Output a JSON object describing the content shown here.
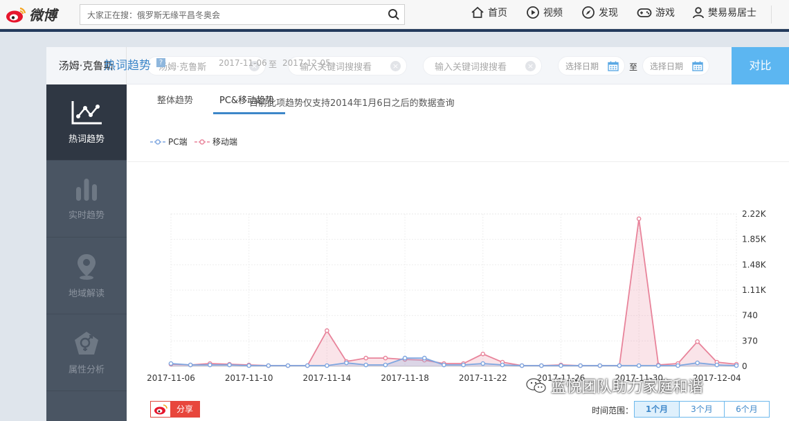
{
  "header": {
    "logo_text": "微博",
    "search_text": "大家正在搜：俄罗斯无缘平昌冬奥会",
    "nav": [
      {
        "label": "首页",
        "icon": "home-icon"
      },
      {
        "label": "视频",
        "icon": "play-icon"
      },
      {
        "label": "发现",
        "icon": "compass-icon"
      },
      {
        "label": "游戏",
        "icon": "gamepad-icon"
      },
      {
        "label": "樊易易居士",
        "icon": "user-icon"
      }
    ]
  },
  "filter": {
    "name_label": "汤姆·克鲁斯",
    "keyword1": "汤姆·克鲁斯",
    "keyword2_placeholder": "输入关键词搜搜看",
    "keyword3_placeholder": "输入关键词搜搜看",
    "date_start_placeholder": "选择日期",
    "to_label": "至",
    "date_end_placeholder": "选择日期",
    "compare_label": "对比"
  },
  "sidebar": {
    "items": [
      {
        "label": "热词趋势",
        "icon": "trend-icon",
        "active": true
      },
      {
        "label": "实时趋势",
        "icon": "bars-icon",
        "active": false
      },
      {
        "label": "地域解读",
        "icon": "location-pin-icon",
        "active": false
      },
      {
        "label": "属性分析",
        "icon": "gender-icon",
        "active": false
      }
    ]
  },
  "content": {
    "title": "热词趋势",
    "help_mark": "?",
    "date_from": "2017-11-06",
    "date_sep": "至",
    "date_to": "2017-12-05",
    "tabs": [
      "整体趋势",
      "PC&移动趋势"
    ],
    "active_tab": "PC&移动趋势",
    "note": "目前此项趋势仅支持2014年1月6日之后的数据查询",
    "share_label": "分享",
    "time_range_label": "时间范围：",
    "range_buttons": [
      "1个月",
      "3个月",
      "6个月"
    ],
    "active_range": "1个月"
  },
  "watermark": "蓝悦团队助力家庭和谐",
  "colors": {
    "pc_series": "#7ea6e0",
    "mobile_series": "#e8839a",
    "accent": "#3d87c9",
    "compare_button": "#5cb6f1",
    "share_button": "#e8463c"
  },
  "chart_data": {
    "type": "area",
    "x_tick_labels": [
      "2017-11-06",
      "2017-11-10",
      "2017-11-14",
      "2017-11-18",
      "2017-11-22",
      "2017-11-26",
      "2017-11-30",
      "2017-12-04"
    ],
    "y_tick_labels": [
      "0",
      "370",
      "740",
      "1.11K",
      "1.48K",
      "1.85K",
      "2.22K"
    ],
    "ylim": [
      0,
      2220
    ],
    "legend_position": "top-left",
    "grid": true,
    "x": [
      "2017-11-06",
      "2017-11-07",
      "2017-11-08",
      "2017-11-09",
      "2017-11-10",
      "2017-11-11",
      "2017-11-12",
      "2017-11-13",
      "2017-11-14",
      "2017-11-15",
      "2017-11-16",
      "2017-11-17",
      "2017-11-18",
      "2017-11-19",
      "2017-11-20",
      "2017-11-21",
      "2017-11-22",
      "2017-11-23",
      "2017-11-24",
      "2017-11-25",
      "2017-11-26",
      "2017-11-27",
      "2017-11-28",
      "2017-11-29",
      "2017-11-30",
      "2017-12-01",
      "2017-12-02",
      "2017-12-03",
      "2017-12-04",
      "2017-12-05"
    ],
    "series": [
      {
        "name": "PC端",
        "values": [
          40,
          20,
          20,
          20,
          10,
          10,
          10,
          10,
          10,
          50,
          20,
          20,
          120,
          120,
          20,
          20,
          40,
          20,
          10,
          10,
          10,
          10,
          10,
          10,
          10,
          10,
          10,
          50,
          20,
          10
        ]
      },
      {
        "name": "移动端",
        "values": [
          30,
          20,
          40,
          30,
          20,
          10,
          10,
          10,
          520,
          70,
          120,
          120,
          100,
          90,
          40,
          40,
          180,
          60,
          10,
          10,
          20,
          10,
          10,
          10,
          2150,
          20,
          40,
          360,
          60,
          30
        ]
      }
    ]
  }
}
